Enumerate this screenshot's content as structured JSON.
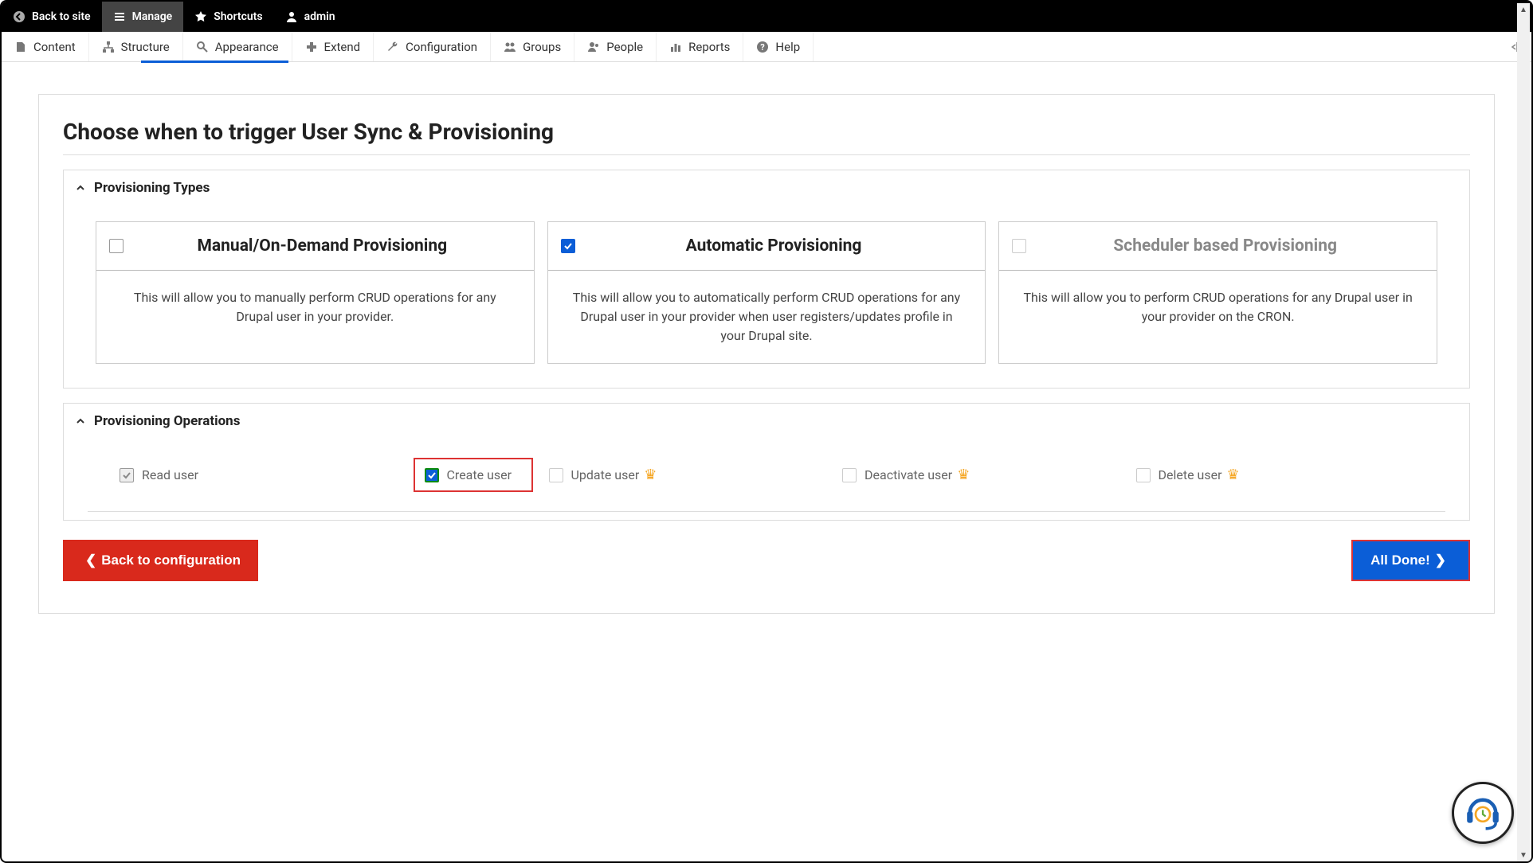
{
  "topbar": {
    "back": "Back to site",
    "manage": "Manage",
    "shortcuts": "Shortcuts",
    "admin": "admin"
  },
  "adminbar": {
    "content": "Content",
    "structure": "Structure",
    "appearance": "Appearance",
    "extend": "Extend",
    "configuration": "Configuration",
    "groups": "Groups",
    "people": "People",
    "reports": "Reports",
    "help": "Help"
  },
  "page": {
    "title": "Choose when to trigger User Sync & Provisioning"
  },
  "sections": {
    "types": "Provisioning Types",
    "ops": "Provisioning Operations"
  },
  "types": [
    {
      "title": "Manual/On-Demand Provisioning",
      "desc": "This will allow you to manually perform CRUD operations for any Drupal user in your provider.",
      "checked": false,
      "disabled": false
    },
    {
      "title": "Automatic Provisioning",
      "desc": "This will allow you to automatically perform CRUD operations for any Drupal user in your provider when user registers/updates profile in your Drupal site.",
      "checked": true,
      "disabled": false
    },
    {
      "title": "Scheduler based Provisioning",
      "desc": "This will allow you to perform CRUD operations for any Drupal user in your provider on the CRON.",
      "checked": false,
      "disabled": true
    }
  ],
  "ops": {
    "read": "Read user",
    "create": "Create user",
    "update": "Update user",
    "deactivate": "Deactivate user",
    "delete": "Delete user"
  },
  "buttons": {
    "back": "Back to configuration",
    "done": "All Done!"
  }
}
